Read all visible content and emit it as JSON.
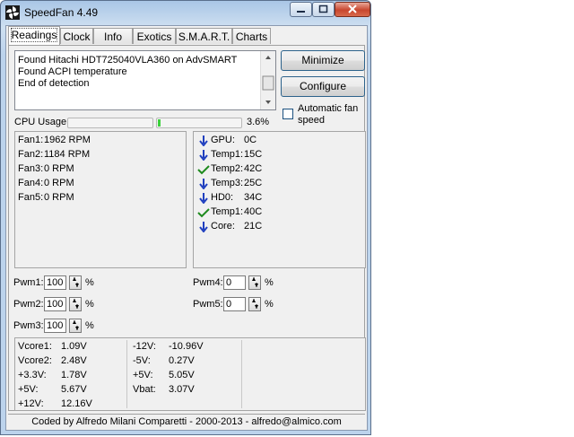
{
  "window": {
    "title": "SpeedFan 4.49"
  },
  "tabs": [
    {
      "label": "Readings"
    },
    {
      "label": "Clock"
    },
    {
      "label": "Info"
    },
    {
      "label": "Exotics"
    },
    {
      "label": "S.M.A.R.T."
    },
    {
      "label": "Charts"
    }
  ],
  "log": {
    "lines": [
      "Found Hitachi HDT725040VLA360 on AdvSMART",
      "Found ACPI temperature",
      "End of detection"
    ]
  },
  "buttons": {
    "minimize": "Minimize",
    "configure": "Configure"
  },
  "auto_fan": {
    "label_line1": "Automatic fan",
    "label_line2": "speed",
    "checked": false
  },
  "cpu_usage": {
    "label": "CPU Usage",
    "value_text": "3.6%",
    "value": 3.6
  },
  "fans": [
    {
      "name": "Fan1:",
      "value": "1962 RPM"
    },
    {
      "name": "Fan2:",
      "value": "1184 RPM"
    },
    {
      "name": "Fan3:",
      "value": "0 RPM"
    },
    {
      "name": "Fan4:",
      "value": "0 RPM"
    },
    {
      "name": "Fan5:",
      "value": "0 RPM"
    }
  ],
  "temps": [
    {
      "name": "GPU:",
      "value": "0C",
      "status": "down-arrow-icon"
    },
    {
      "name": "Temp1:",
      "value": "15C",
      "status": "down-arrow-icon"
    },
    {
      "name": "Temp2:",
      "value": "42C",
      "status": "check-icon"
    },
    {
      "name": "Temp3:",
      "value": "25C",
      "status": "down-arrow-icon"
    },
    {
      "name": "HD0:",
      "value": "34C",
      "status": "down-arrow-icon"
    },
    {
      "name": "Temp1:",
      "value": "40C",
      "status": "check-icon"
    },
    {
      "name": "Core:",
      "value": "21C",
      "status": "down-arrow-icon"
    }
  ],
  "pwm": [
    {
      "label": "Pwm1:",
      "value": "100",
      "unit": "%"
    },
    {
      "label": "Pwm2:",
      "value": "100",
      "unit": "%"
    },
    {
      "label": "Pwm3:",
      "value": "100",
      "unit": "%"
    },
    {
      "label": "Pwm4:",
      "value": "0",
      "unit": "%"
    },
    {
      "label": "Pwm5:",
      "value": "0",
      "unit": "%"
    }
  ],
  "voltages_col1": [
    {
      "name": "Vcore1:",
      "value": "1.09V"
    },
    {
      "name": "Vcore2:",
      "value": "2.48V"
    },
    {
      "name": "+3.3V:",
      "value": "1.78V"
    },
    {
      "name": "+5V:",
      "value": "5.67V"
    },
    {
      "name": "+12V:",
      "value": "12.16V"
    }
  ],
  "voltages_col2": [
    {
      "name": "-12V:",
      "value": "-10.96V"
    },
    {
      "name": "-5V:",
      "value": "0.27V"
    },
    {
      "name": "+5V:",
      "value": "5.05V"
    },
    {
      "name": "Vbat:",
      "value": "3.07V"
    }
  ],
  "status_bar": {
    "text": "Coded by Alfredo Milani Comparetti - 2000-2013 - alfredo@almico.com"
  },
  "colors": {
    "down_arrow": "#1f3fbf",
    "check": "#1e8a1e",
    "cpu_bar": "#3cd13c"
  }
}
